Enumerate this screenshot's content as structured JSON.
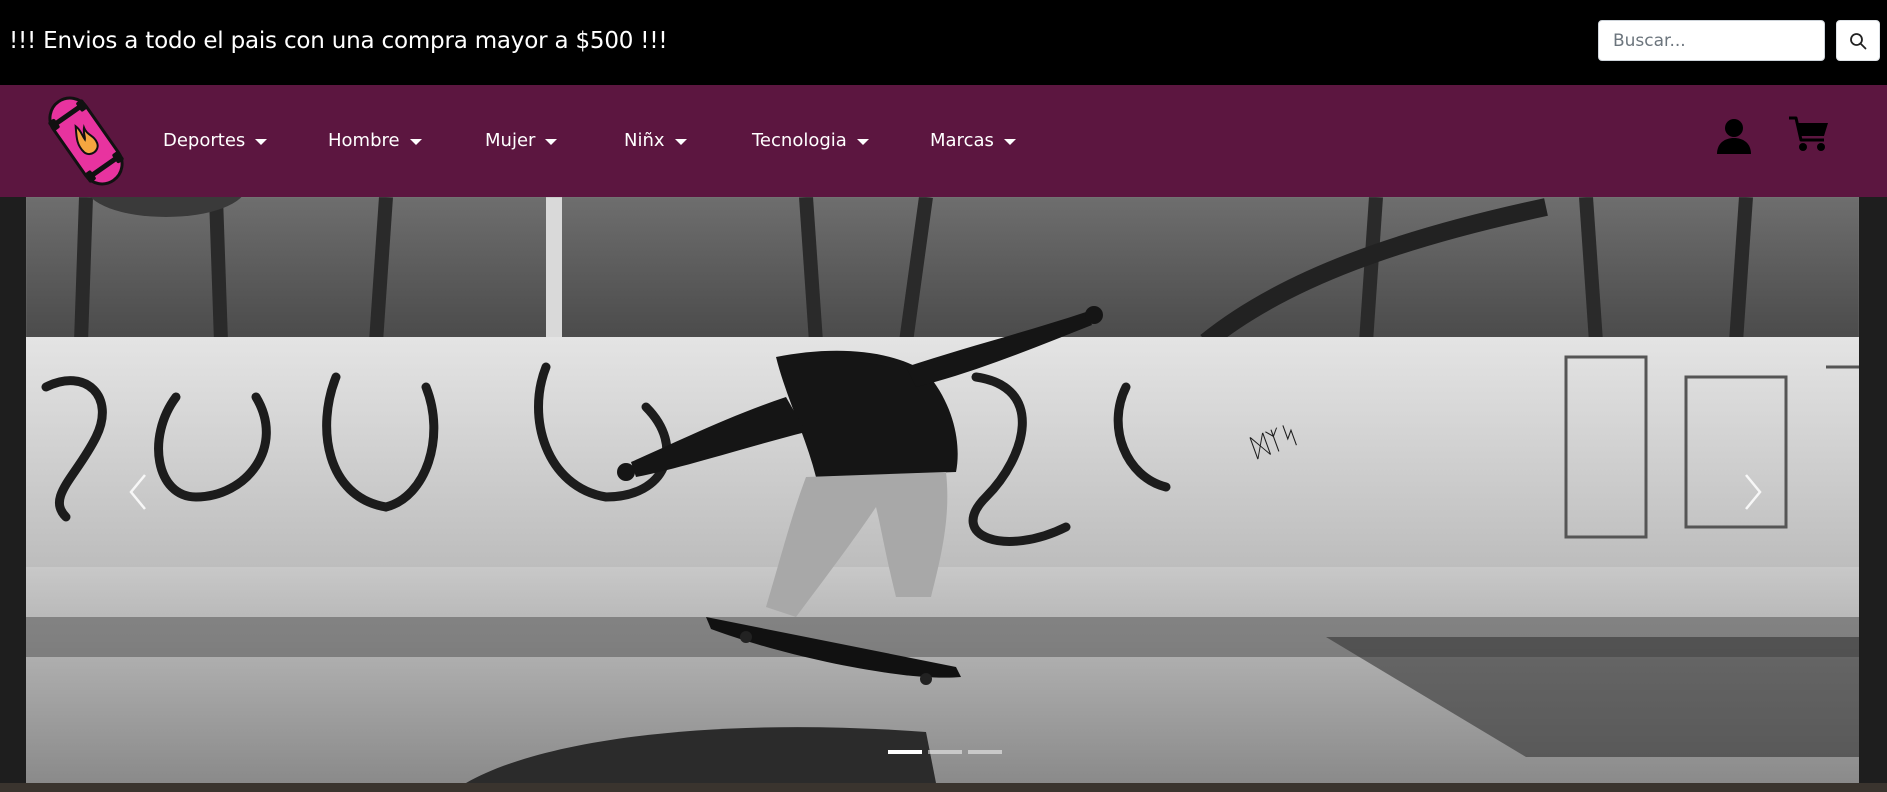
{
  "topbar": {
    "promo_text": "!!! Envios a todo el pais con una compra mayor a $500 !!!",
    "search": {
      "placeholder": "Buscar...",
      "value": "",
      "button_icon": "search-icon"
    }
  },
  "navbar": {
    "logo_icon": "skateboard-logo",
    "items": [
      {
        "label": "Deportes",
        "icon": "caret-down-icon"
      },
      {
        "label": "Hombre",
        "icon": "caret-down-icon"
      },
      {
        "label": "Mujer",
        "icon": "caret-down-icon"
      },
      {
        "label": "Niñx",
        "icon": "caret-down-icon"
      },
      {
        "label": "Tecnologia",
        "icon": "caret-down-icon"
      },
      {
        "label": "Marcas",
        "icon": "caret-down-icon"
      }
    ],
    "right_icons": [
      "user-icon",
      "cart-icon"
    ]
  },
  "carousel": {
    "slide_count": 3,
    "active_slide": 1,
    "prev_icon": "chevron-left-icon",
    "next_icon": "chevron-right-icon"
  },
  "colors": {
    "topbar_bg": "#000000",
    "navbar_bg": "#5c1640",
    "logo_pink": "#e8339f"
  }
}
